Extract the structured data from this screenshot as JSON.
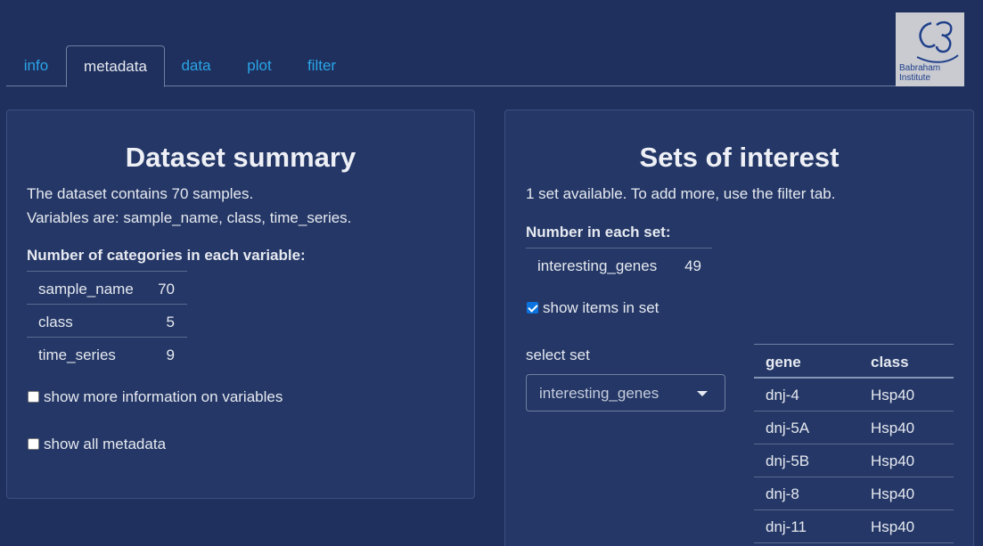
{
  "tabs": [
    {
      "label": "info",
      "active": false
    },
    {
      "label": "metadata",
      "active": true
    },
    {
      "label": "data",
      "active": false
    },
    {
      "label": "plot",
      "active": false
    },
    {
      "label": "filter",
      "active": false
    }
  ],
  "logo": {
    "line1": "Babraham",
    "line2": "Institute"
  },
  "dataset_summary": {
    "title": "Dataset summary",
    "line1": "The dataset contains 70 samples.",
    "line2": "Variables are: sample_name, class, time_series.",
    "categories_heading": "Number of categories in each variable:",
    "categories": [
      {
        "name": "sample_name",
        "count": "70"
      },
      {
        "name": "class",
        "count": "5"
      },
      {
        "name": "time_series",
        "count": "9"
      }
    ],
    "show_more_label": "show more information on variables",
    "show_more_checked": false,
    "show_all_label": "show all metadata",
    "show_all_checked": false
  },
  "sets_of_interest": {
    "title": "Sets of interest",
    "info": "1 set available. To add more, use the filter tab.",
    "number_heading": "Number in each set:",
    "sets": [
      {
        "name": "interesting_genes",
        "count": "49"
      }
    ],
    "show_items_label": "show items in set",
    "show_items_checked": true,
    "select_label": "select set",
    "select_value": "interesting_genes",
    "table_headers": [
      "gene",
      "class"
    ],
    "table_rows": [
      {
        "gene": "dnj-4",
        "class": "Hsp40"
      },
      {
        "gene": "dnj-5A",
        "class": "Hsp40"
      },
      {
        "gene": "dnj-5B",
        "class": "Hsp40"
      },
      {
        "gene": "dnj-8",
        "class": "Hsp40"
      },
      {
        "gene": "dnj-11",
        "class": "Hsp40"
      }
    ]
  },
  "colors": {
    "background": "#1f305e",
    "panel": "#243766",
    "tab_link": "#2aa5e6",
    "checkbox_checked": "#0b73e0"
  }
}
